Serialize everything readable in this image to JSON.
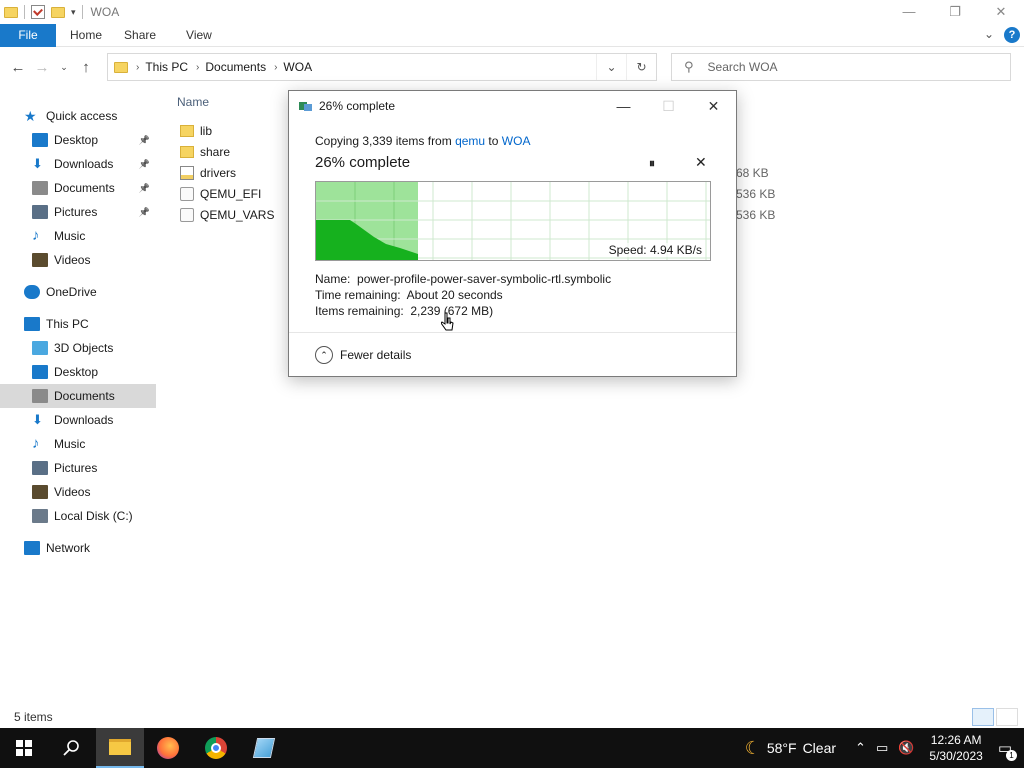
{
  "window": {
    "title": "WOA",
    "minimize": "—",
    "restore": "❐",
    "close": "✕"
  },
  "ribbon": {
    "tabs": [
      "File",
      "Home",
      "Share",
      "View"
    ],
    "expand": "⌄",
    "help": "?"
  },
  "address": {
    "crumbs": [
      "This PC",
      "Documents",
      "WOA"
    ],
    "search_placeholder": "Search WOA"
  },
  "sidebar": {
    "items": [
      {
        "label": "Quick access",
        "icon": "star-icon",
        "color": "#1979ca"
      },
      {
        "label": "Desktop",
        "icon": "desktop-icon",
        "color": "#1979ca"
      },
      {
        "label": "Downloads",
        "icon": "download-icon",
        "color": "#1979ca"
      },
      {
        "label": "Documents",
        "icon": "documents-icon",
        "color": "#8a8a8a"
      },
      {
        "label": "Pictures",
        "icon": "pictures-icon",
        "color": "#5a6f86"
      },
      {
        "label": "Music",
        "icon": "music-icon",
        "color": "#1979ca"
      },
      {
        "label": "Videos",
        "icon": "videos-icon",
        "color": "#5a4b2e"
      },
      {
        "label": "OneDrive",
        "icon": "cloud-icon",
        "color": "#1979ca"
      },
      {
        "label": "This PC",
        "icon": "pc-icon",
        "color": "#1979ca"
      },
      {
        "label": "3D Objects",
        "icon": "cube-icon",
        "color": "#4aa8e0"
      },
      {
        "label": "Desktop",
        "icon": "desktop-icon",
        "color": "#1979ca"
      },
      {
        "label": "Documents",
        "icon": "documents-icon",
        "color": "#8a8a8a"
      },
      {
        "label": "Downloads",
        "icon": "download-icon",
        "color": "#1979ca"
      },
      {
        "label": "Music",
        "icon": "music-icon",
        "color": "#1979ca"
      },
      {
        "label": "Pictures",
        "icon": "pictures-icon",
        "color": "#5a6f86"
      },
      {
        "label": "Videos",
        "icon": "videos-icon",
        "color": "#5a4b2e"
      },
      {
        "label": "Local Disk (C:)",
        "icon": "drive-icon",
        "color": "#6b7a8a"
      },
      {
        "label": "Network",
        "icon": "network-icon",
        "color": "#1979ca"
      }
    ]
  },
  "files": {
    "column_name": "Name",
    "rows": [
      {
        "name": "lib",
        "type": "folder",
        "size": ""
      },
      {
        "name": "share",
        "type": "folder",
        "size": ""
      },
      {
        "name": "drivers",
        "type": "installer",
        "size": "68 KB"
      },
      {
        "name": "QEMU_EFI",
        "type": "file",
        "size": "536 KB"
      },
      {
        "name": "QEMU_VARS",
        "type": "file",
        "size": "536 KB"
      }
    ]
  },
  "status": {
    "items": "5 items"
  },
  "dialog": {
    "title": "26% complete",
    "copying_prefix": "Copying 3,339 items from ",
    "source": "qemu",
    "to": " to ",
    "dest": "WOA",
    "percent_label": "26% complete",
    "pause": "⏸",
    "cancel": "✕",
    "speed": "Speed: 4.94 KB/s",
    "progress_fraction": 0.26,
    "name_label": "Name:",
    "name_value": "power-profile-power-saver-symbolic-rtl.symbolic",
    "time_label": "Time remaining:",
    "time_value": "About 20 seconds",
    "items_label": "Items remaining:",
    "items_value": "2,239 (672 MB)",
    "fewer_details": "Fewer details",
    "colors": {
      "fill_light": "#9ee39a",
      "fill_dark": "#16b11e",
      "grid": "#cfe8cf"
    }
  },
  "taskbar": {
    "weather_temp": "58°F",
    "weather_desc": "Clear",
    "time": "12:26 AM",
    "date": "5/30/2023",
    "notification_count": "1"
  }
}
